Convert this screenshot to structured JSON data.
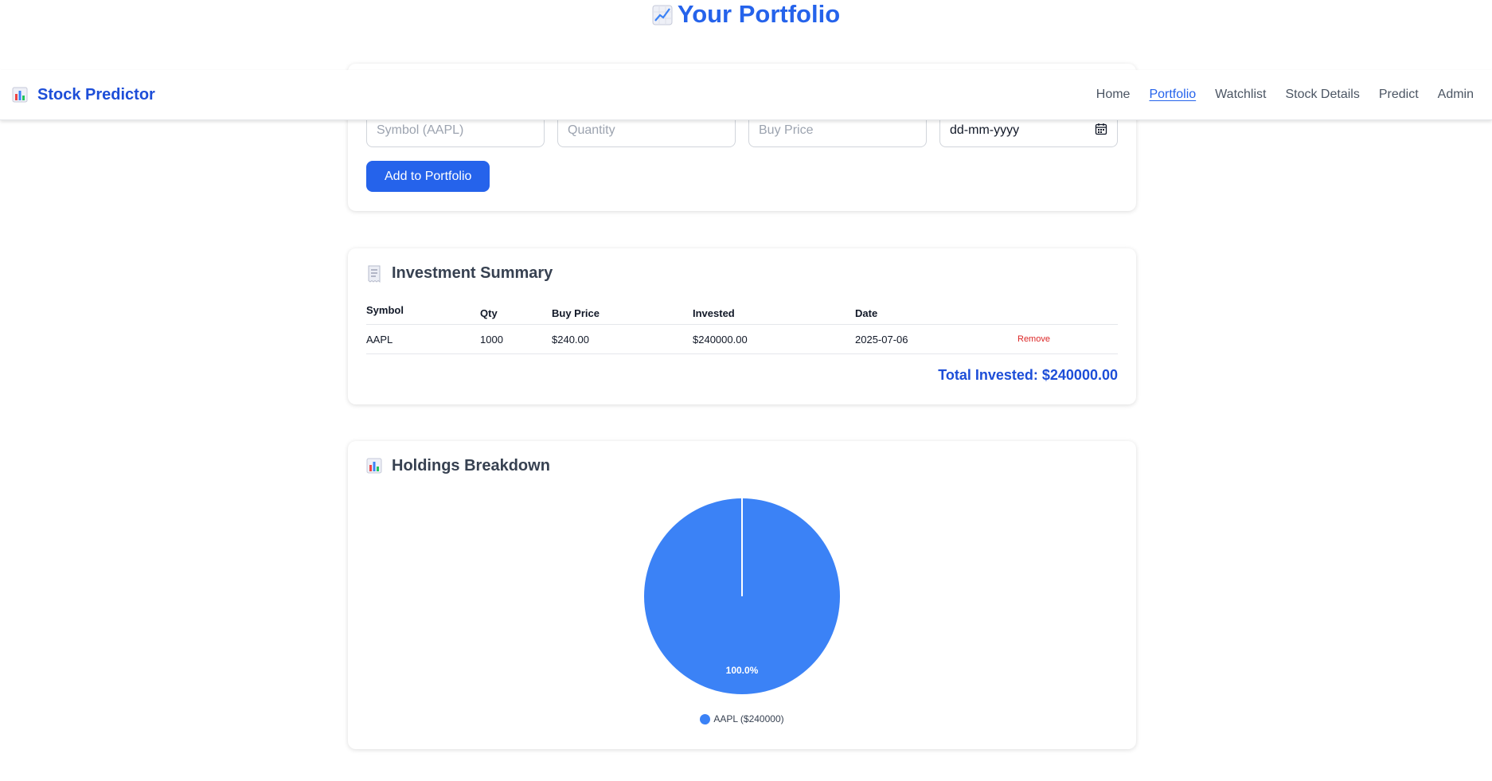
{
  "page": {
    "title": "Your Portfolio",
    "title_icon": "chart-increasing-icon"
  },
  "nav": {
    "brand": "Stock Predictor",
    "brand_icon": "bar-chart-icon",
    "links": [
      "Home",
      "Portfolio",
      "Watchlist",
      "Stock Details",
      "Predict",
      "Admin"
    ],
    "active": "Portfolio"
  },
  "form": {
    "symbol_placeholder": "Symbol (AAPL)",
    "quantity_placeholder": "Quantity",
    "price_placeholder": "Buy Price",
    "date_placeholder": "dd-mm-yyyy",
    "date_icon": "calendar-icon",
    "submit_label": "Add to Portfolio"
  },
  "summary": {
    "heading": "Investment Summary",
    "heading_icon": "receipt-icon",
    "columns": [
      "Symbol",
      "Qty",
      "Buy Price",
      "Invested",
      "Date"
    ],
    "rows": [
      {
        "symbol": "AAPL",
        "qty": "1000",
        "buy_price": "$240.00",
        "invested": "$240000.00",
        "date": "2025-07-06",
        "action": "Remove"
      }
    ],
    "total": "Total Invested: $240000.00"
  },
  "holdings": {
    "heading": "Holdings Breakdown",
    "heading_icon": "bar-chart-icon"
  },
  "chart_data": {
    "type": "pie",
    "categories": [
      "AAPL"
    ],
    "values": [
      240000
    ],
    "percent_labels": [
      "100.0%"
    ],
    "legend": [
      "AAPL ($240000)"
    ],
    "colors": [
      "#3b82f6"
    ],
    "legend_position": "bottom"
  },
  "colors": {
    "accent": "#2563eb",
    "brand": "#1d4ed8",
    "danger": "#dc2626",
    "pie": "#3b82f6"
  }
}
